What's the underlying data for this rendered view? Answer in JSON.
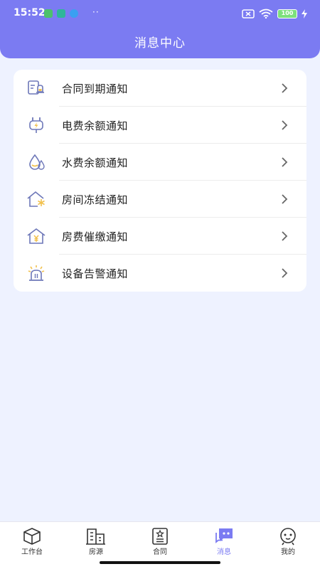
{
  "status_bar": {
    "time": "15:52",
    "dots": "··",
    "battery": "100"
  },
  "header": {
    "title": "消息中心"
  },
  "notifications": [
    {
      "label": "合同到期通知",
      "icon": "contract-clock-icon"
    },
    {
      "label": "电费余额通知",
      "icon": "electric-plug-icon"
    },
    {
      "label": "水费余额通知",
      "icon": "water-drop-icon"
    },
    {
      "label": "房间冻结通知",
      "icon": "house-snowflake-icon"
    },
    {
      "label": "房费催缴通知",
      "icon": "house-yuan-icon"
    },
    {
      "label": "设备告警通知",
      "icon": "alarm-light-icon"
    }
  ],
  "tabs": [
    {
      "label": "工作台",
      "icon": "cube-icon",
      "active": false
    },
    {
      "label": "房源",
      "icon": "buildings-icon",
      "active": false
    },
    {
      "label": "合同",
      "icon": "document-icon",
      "active": false
    },
    {
      "label": "消息",
      "icon": "chat-icon",
      "active": true
    },
    {
      "label": "我的",
      "icon": "profile-face-icon",
      "active": false
    }
  ],
  "colors": {
    "accent": "#7b7bf2",
    "background": "#eef2ff",
    "icon_stroke": "#6d77b8",
    "icon_accent": "#f2c14e"
  }
}
